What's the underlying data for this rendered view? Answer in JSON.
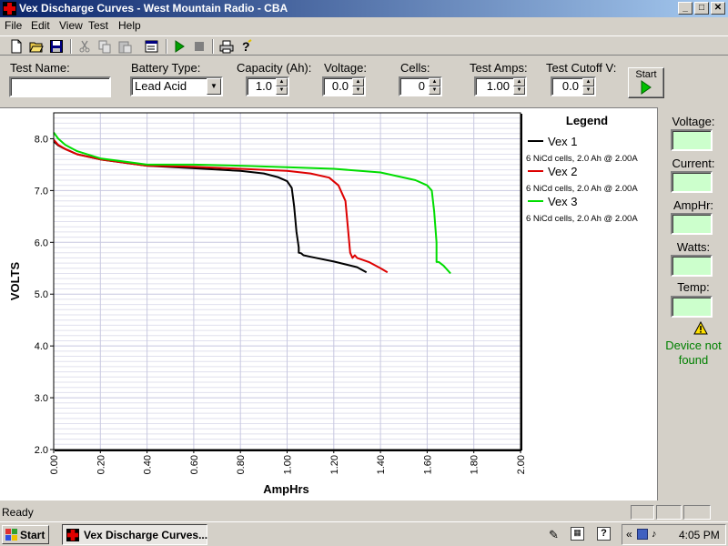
{
  "window": {
    "title": "Vex Discharge Curves - West Mountain Radio - CBA"
  },
  "menu": [
    "File",
    "Edit",
    "View",
    "Test",
    "Help"
  ],
  "toolbar": [
    "new",
    "open",
    "save",
    "cut",
    "copy",
    "paste",
    "properties",
    "run",
    "stop",
    "print",
    "help"
  ],
  "params": {
    "test_name": {
      "label": "Test Name:",
      "value": ""
    },
    "battery_type": {
      "label": "Battery Type:",
      "value": "Lead Acid"
    },
    "capacity": {
      "label": "Capacity (Ah):",
      "value": "1.0"
    },
    "voltage": {
      "label": "Voltage:",
      "value": "0.0"
    },
    "cells": {
      "label": "Cells:",
      "value": "0"
    },
    "test_amps": {
      "label": "Test Amps:",
      "value": "1.00"
    },
    "test_cutoff": {
      "label": "Test Cutoff V:",
      "value": "0.0"
    },
    "start_label": "Start"
  },
  "side": {
    "voltage_label": "Voltage:",
    "current_label": "Current:",
    "amphr_label": "AmpHr:",
    "watts_label": "Watts:",
    "temp_label": "Temp:",
    "status_text": "Device not found",
    "box_color": "#ccffcc",
    "status_color": "#008000"
  },
  "status": {
    "text": "Ready"
  },
  "taskbar": {
    "start": "Start",
    "task": "Vex Discharge Curves...",
    "clock": "4:05 PM",
    "arrows": "«"
  },
  "chart_data": {
    "type": "line",
    "xlabel": "AmpHrs",
    "ylabel": "VOLTS",
    "xlim": [
      0,
      2.0
    ],
    "ylim": [
      2.0,
      8.5
    ],
    "xticks": [
      "0.00",
      "0.20",
      "0.40",
      "0.60",
      "0.80",
      "1.00",
      "1.20",
      "1.40",
      "1.60",
      "1.80",
      "2.00"
    ],
    "yticks": [
      "2.0",
      "3.0",
      "4.0",
      "5.0",
      "6.0",
      "7.0",
      "8.0"
    ],
    "grid": true,
    "legend_title": "Legend",
    "legend_placement": "right",
    "series": [
      {
        "name": "Vex 1",
        "description": "6 NiCd cells, 2.0 Ah @ 2.00A",
        "color": "#000000",
        "x": [
          0.0,
          0.02,
          0.05,
          0.1,
          0.2,
          0.4,
          0.6,
          0.8,
          0.9,
          0.96,
          1.0,
          1.02,
          1.03,
          1.04,
          1.05,
          1.05,
          1.06,
          1.07,
          1.1,
          1.2,
          1.3,
          1.34
        ],
        "y": [
          7.95,
          7.87,
          7.8,
          7.7,
          7.6,
          7.48,
          7.43,
          7.38,
          7.33,
          7.26,
          7.18,
          7.05,
          6.7,
          6.2,
          5.9,
          5.8,
          5.79,
          5.75,
          5.72,
          5.63,
          5.52,
          5.42
        ]
      },
      {
        "name": "Vex 2",
        "description": "6 NiCd cells, 2.0 Ah @ 2.00A",
        "color": "#dd0000",
        "x": [
          0.0,
          0.02,
          0.05,
          0.1,
          0.2,
          0.4,
          0.6,
          0.8,
          1.0,
          1.1,
          1.18,
          1.22,
          1.25,
          1.26,
          1.27,
          1.28,
          1.29,
          1.3,
          1.35,
          1.4,
          1.43
        ],
        "y": [
          7.98,
          7.88,
          7.8,
          7.7,
          7.6,
          7.48,
          7.46,
          7.42,
          7.38,
          7.33,
          7.25,
          7.1,
          6.8,
          6.3,
          5.8,
          5.7,
          5.75,
          5.7,
          5.62,
          5.5,
          5.42
        ]
      },
      {
        "name": "Vex 3",
        "description": "6 NiCd cells, 2.0 Ah @ 2.00A",
        "color": "#00dd00",
        "x": [
          0.0,
          0.02,
          0.05,
          0.1,
          0.2,
          0.4,
          0.6,
          0.8,
          1.0,
          1.2,
          1.4,
          1.55,
          1.6,
          1.62,
          1.63,
          1.64,
          1.64,
          1.65,
          1.67,
          1.7
        ],
        "y": [
          8.12,
          8.0,
          7.88,
          7.76,
          7.62,
          7.5,
          7.5,
          7.48,
          7.45,
          7.42,
          7.35,
          7.2,
          7.1,
          7.0,
          6.6,
          6.0,
          5.62,
          5.62,
          5.55,
          5.4
        ]
      }
    ]
  }
}
